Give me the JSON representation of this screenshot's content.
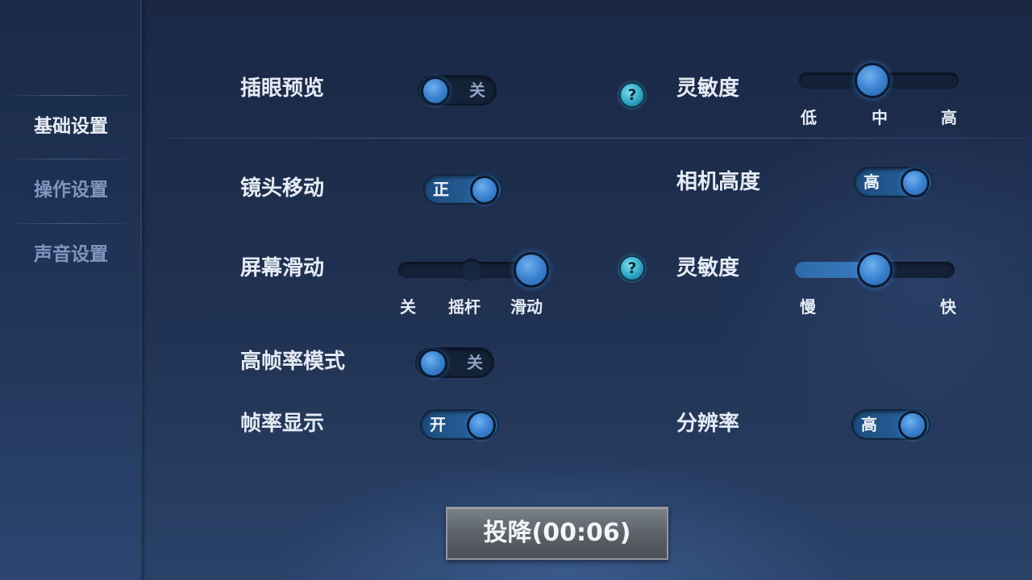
{
  "sidebar": {
    "items": [
      {
        "label": "基础设置",
        "active": true
      },
      {
        "label": "操作设置",
        "active": false
      },
      {
        "label": "声音设置",
        "active": false
      }
    ]
  },
  "settings": {
    "ward_preview": {
      "label": "插眼预览",
      "state": "关",
      "on": false,
      "help": "?"
    },
    "sensitivity_top": {
      "label": "灵敏度",
      "options": [
        "低",
        "中",
        "高"
      ],
      "selected": "中"
    },
    "camera_move": {
      "label": "镜头移动",
      "state": "正",
      "on": true
    },
    "camera_height": {
      "label": "相机高度",
      "state": "高",
      "on": true
    },
    "screen_slide": {
      "label": "屏幕滑动",
      "options": [
        "关",
        "摇杆",
        "滑动"
      ],
      "selected": "滑动",
      "help": "?"
    },
    "sensitivity_bottom": {
      "label": "灵敏度",
      "min_label": "慢",
      "max_label": "快",
      "value_fraction": 0.5
    },
    "high_fps": {
      "label": "高帧率模式",
      "state": "关",
      "on": false
    },
    "fps_display": {
      "label": "帧率显示",
      "state": "开",
      "on": true
    },
    "resolution": {
      "label": "分辨率",
      "state": "高",
      "on": true
    }
  },
  "surrender_button": {
    "label": "投降(00:06)"
  },
  "colors": {
    "accent_blue": "#3b82d0",
    "help_cyan": "#2fa6c4",
    "sidebar_active": "#e9eef6",
    "sidebar_inactive": "#7f97bf"
  }
}
